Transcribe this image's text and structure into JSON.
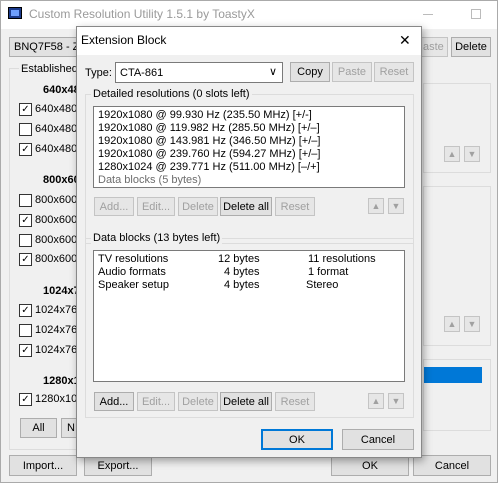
{
  "main_window": {
    "title": "Custom Resolution Utility 1.5.1 by ToastyX",
    "monitor_select": "BNQ7F58 - Z",
    "paste_label": "aste",
    "delete_label": "Delete",
    "established_label": "Established",
    "groups": [
      {
        "heading": "640x48",
        "items": [
          {
            "label": "640x480",
            "checked": true
          },
          {
            "label": "640x480",
            "checked": false
          },
          {
            "label": "640x480",
            "checked": true
          }
        ]
      },
      {
        "heading": "800x60",
        "items": [
          {
            "label": "800x600",
            "checked": false
          },
          {
            "label": "800x600",
            "checked": true
          },
          {
            "label": "800x600",
            "checked": false
          },
          {
            "label": "800x600",
            "checked": true
          }
        ]
      },
      {
        "heading": "1024x7",
        "items": [
          {
            "label": "1024x76",
            "checked": true
          },
          {
            "label": "1024x76",
            "checked": false
          },
          {
            "label": "1024x76",
            "checked": true
          }
        ]
      },
      {
        "heading": "1280x1",
        "items": [
          {
            "label": "1280x10",
            "checked": true
          }
        ]
      }
    ],
    "all_label": "All",
    "none_label": "N",
    "import_label": "Import...",
    "export_label": "Export...",
    "ok_label": "OK",
    "cancel_label": "Cancel"
  },
  "dialog": {
    "title": "Extension Block",
    "type_label": "Type:",
    "type_value": "CTA-861",
    "copy_label": "Copy",
    "paste_label": "Paste",
    "reset_label": "Reset",
    "detailed": {
      "legend": "Detailed resolutions (0 slots left)",
      "rows": [
        "1920x1080 @ 99.930 Hz (235.50 MHz) [+/-]",
        "1920x1080 @ 119.982 Hz (285.50 MHz) [+/–]",
        "1920x1080 @ 143.981 Hz (346.50 MHz) [+/–]",
        "1920x1080 @ 239.760 Hz (594.27 MHz) [+/–]",
        "1280x1024 @ 239.771 Hz (511.00 MHz) [–/+]"
      ],
      "footer_row": "Data blocks (5 bytes)",
      "add_label": "Add...",
      "edit_label": "Edit...",
      "delete_label": "Delete",
      "delete_all_label": "Delete all",
      "reset_label": "Reset"
    },
    "data_blocks": {
      "legend": "Data blocks (13 bytes left)",
      "rows": [
        {
          "name": "TV resolutions",
          "size": "12 bytes",
          "info": "11 resolutions"
        },
        {
          "name": "Audio formats",
          "size": "4 bytes",
          "info": "1 format"
        },
        {
          "name": "Speaker setup",
          "size": "4 bytes",
          "info": "Stereo"
        }
      ],
      "add_label": "Add...",
      "edit_label": "Edit...",
      "delete_label": "Delete",
      "delete_all_label": "Delete all",
      "reset_label": "Reset"
    },
    "ok_label": "OK",
    "cancel_label": "Cancel"
  },
  "icons": {
    "up": "▲",
    "down": "▼",
    "close": "✕",
    "dropdown": "∨",
    "check": "✓"
  },
  "colors": {
    "accent": "#0078d7",
    "selection": "#0078d7"
  }
}
